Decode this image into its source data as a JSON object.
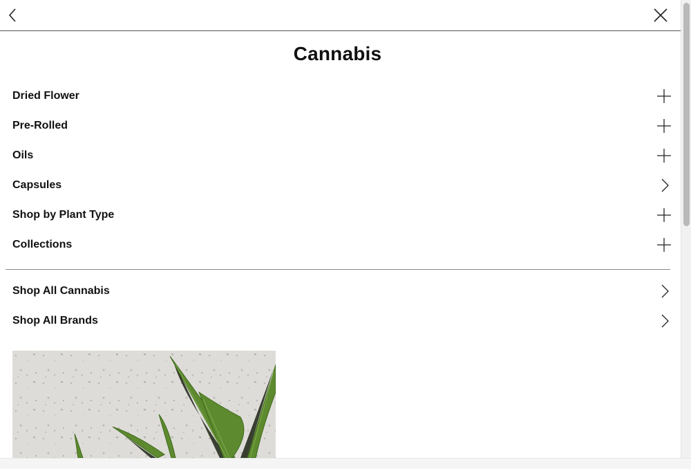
{
  "header": {
    "back_icon": "chevron-left-icon",
    "close_icon": "close-icon"
  },
  "page": {
    "title": "Cannabis"
  },
  "menu": {
    "items": [
      {
        "label": "Dried Flower",
        "icon": "plus-icon"
      },
      {
        "label": "Pre-Rolled",
        "icon": "plus-icon"
      },
      {
        "label": "Oils",
        "icon": "plus-icon"
      },
      {
        "label": "Capsules",
        "icon": "chevron-right-icon"
      },
      {
        "label": "Shop by Plant Type",
        "icon": "plus-icon"
      },
      {
        "label": "Collections",
        "icon": "plus-icon"
      }
    ]
  },
  "shop_links": {
    "items": [
      {
        "label": "Shop All Cannabis",
        "icon": "chevron-right-icon"
      },
      {
        "label": "Shop All Brands",
        "icon": "chevron-right-icon"
      }
    ]
  },
  "promo": {
    "image": "cannabis-leaf-on-terrazzo"
  },
  "colors": {
    "text": "#111111",
    "divider": "#888888",
    "leaf": "#5d8a2e",
    "background_stone": "#dcdad6"
  }
}
